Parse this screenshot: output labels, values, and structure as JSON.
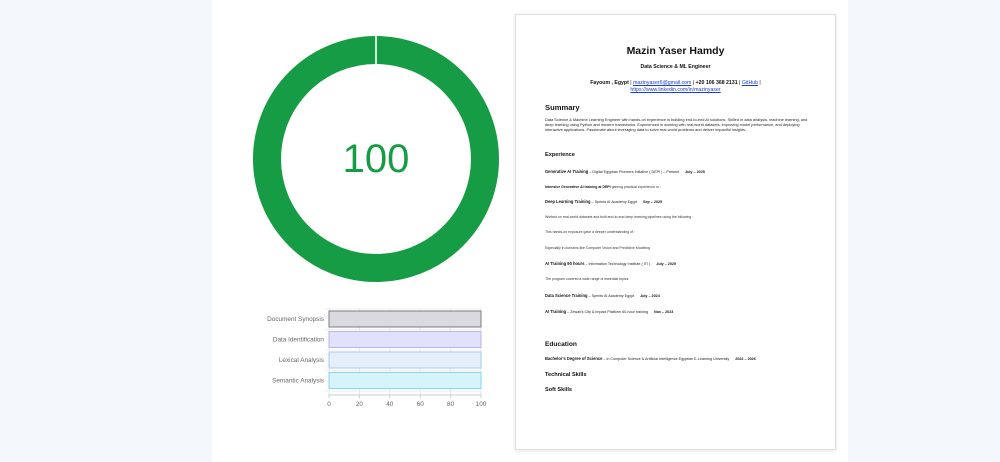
{
  "gauge": {
    "value": 100,
    "display": "100",
    "color": "#169c44"
  },
  "bar_chart": {
    "categories": [
      "Document Synopsis",
      "Data Identification",
      "Lexical Analysis",
      "Semantic Analysis"
    ],
    "values": [
      100,
      100,
      100,
      100
    ],
    "fills": [
      "#d9d9de",
      "#e1e1fb",
      "#e4effb",
      "#d6f4fb"
    ],
    "strokes": [
      "#7c7c86",
      "#b4b4f1",
      "#a8c8ee",
      "#86d6ec"
    ],
    "ticks": [
      "0",
      "20",
      "40",
      "60",
      "80",
      "100"
    ],
    "xlim": [
      0,
      100
    ]
  },
  "resume": {
    "name": "Mazin Yaser Hamdy",
    "role": "Data Science & ML Engineer",
    "contact": {
      "location": "Fayoum , Egypt",
      "sep1": " | ",
      "email": "mazinyaser6@gmail.com",
      "sep2": " | ",
      "phone": "+20 106 368 2131",
      "sep3": " | ",
      "github": "GitHub",
      "sep4": " |",
      "linkedin": "https://www.linkedin.com/in/mazinyaser"
    },
    "summary": {
      "heading": "Summary",
      "text": "Data Science & Machine Learning Engineer with hands-on experience in building end-to-end AI solutions. Skilled in data analysis, machine learning, and deep learning using Python and modern frameworks. Experienced in working with real-world datasets, improving model performance, and deploying interactive applications. Passionate about leveraging data to solve real-world problems and deliver impactful insights."
    },
    "experience": {
      "heading": "Experience",
      "items": [
        {
          "title": "Generative AI Training",
          "org": " – Digital Egyptian Pioneers Initiative ( DEPI ) – Present",
          "date": "July – 2025"
        },
        {
          "title": "Intensive Generative AI training at DEPI",
          "org": " gaining practical experience in :",
          "date": ""
        },
        {
          "title": "Deep Learning Training",
          "org": " – Sprints AI Academy Egypt",
          "date": "Sep – 2025"
        },
        {
          "title": "",
          "org": "Worked on real-world datasets and built end-to-end deep learning pipelines using the following :",
          "date": ""
        },
        {
          "title": "",
          "org": "This hands-on exposure gave a deeper understanding of :",
          "date": ""
        },
        {
          "title": "",
          "org": "Especially in domains like Computer Vision and Predictive Modeling",
          "date": ""
        },
        {
          "title": "AI Training 90 hours",
          "org": " – Information Technology Institute ( ITI )",
          "date": "July – 2025"
        },
        {
          "title": "",
          "org": "The program covered a wide range of essential topics:",
          "date": ""
        },
        {
          "title": "Data Science Training",
          "org": " – Sprints AI Academy Egypt",
          "date": "July – 2024"
        },
        {
          "title": "AI Training",
          "org": " – Zewail's City & Impact Platform 60-hour training",
          "date": "Nov – 2023"
        }
      ]
    },
    "education": {
      "heading": "Education",
      "degree": "Bachelor's Degree of Science",
      "detail": " – in Computer Science & Artificial Intelligence Egyptian E-Learning University",
      "date": "2022 – 2026"
    },
    "technical_skills": "Technical Skills",
    "soft_skills": "Soft Skills"
  }
}
